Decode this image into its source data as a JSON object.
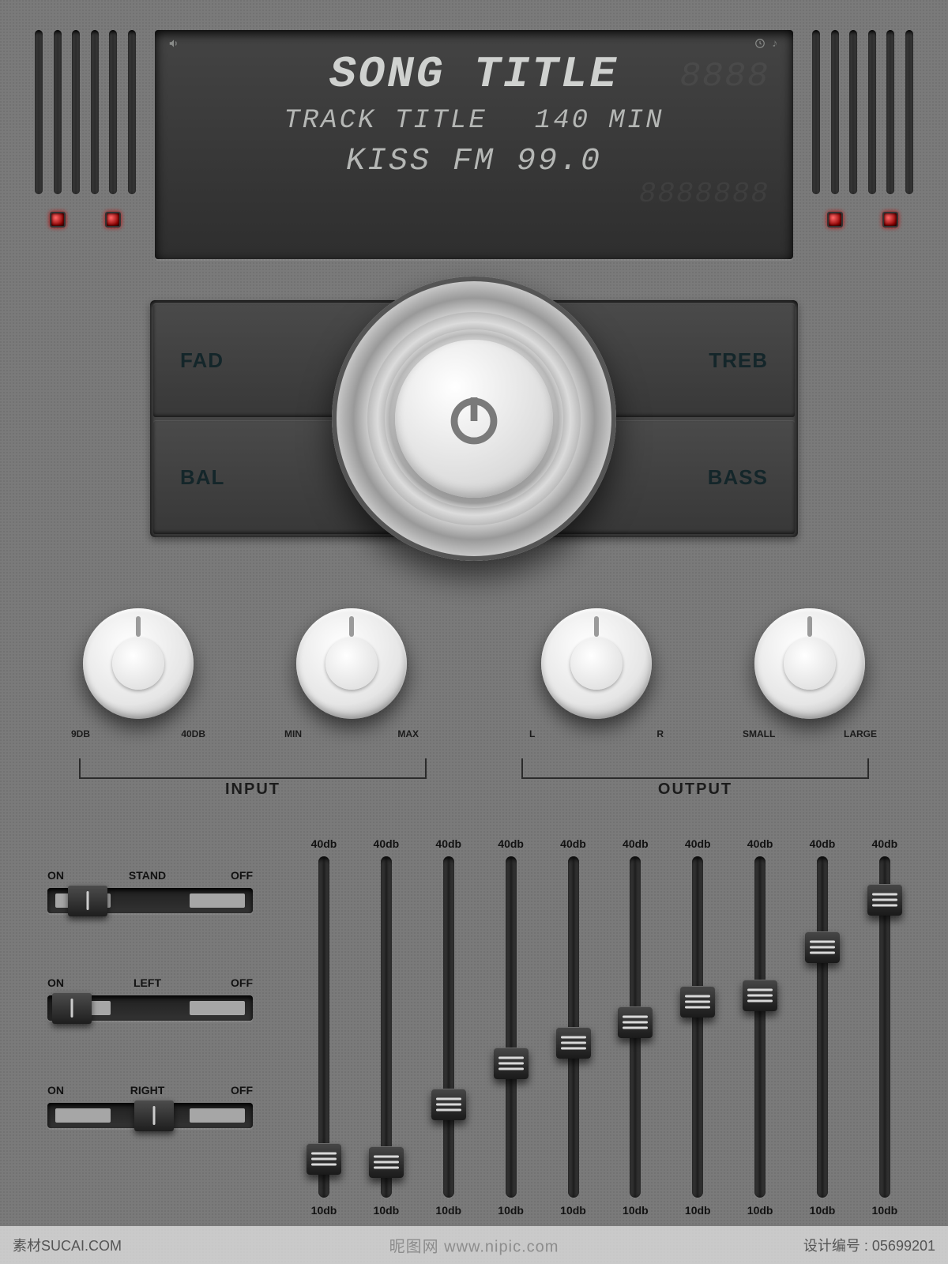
{
  "display": {
    "song_title": "SONG TITLE",
    "track_title": "TRACK TITLE",
    "duration": "140 MIN",
    "station": "KISS FM 99.0"
  },
  "eq_buttons": {
    "fad": "FAD",
    "treb": "TREB",
    "bal": "BAL",
    "bass": "BASS"
  },
  "knobs": [
    {
      "min_label": "9DB",
      "max_label": "40DB"
    },
    {
      "min_label": "MIN",
      "max_label": "MAX"
    },
    {
      "min_label": "L",
      "max_label": "R"
    },
    {
      "min_label": "SMALL",
      "max_label": "LARGE"
    }
  ],
  "knob_groups": {
    "input": "INPUT",
    "output": "OUTPUT"
  },
  "switches": [
    {
      "on": "ON",
      "mid": "STAND",
      "off": "OFF",
      "pos": 26
    },
    {
      "on": "ON",
      "mid": "LEFT",
      "off": "OFF",
      "pos": 6
    },
    {
      "on": "ON",
      "mid": "RIGHT",
      "off": "OFF",
      "pos": 110
    }
  ],
  "faders": {
    "top_label": "40db",
    "bottom_label": "10db",
    "positions": [
      84,
      85,
      68,
      56,
      50,
      44,
      38,
      36,
      22,
      8
    ]
  },
  "footer": {
    "left": "素材SUCAI.COM",
    "watermark": "昵图网 www.nipic.com",
    "right_label": "设计编号",
    "right_id": "05699201"
  }
}
